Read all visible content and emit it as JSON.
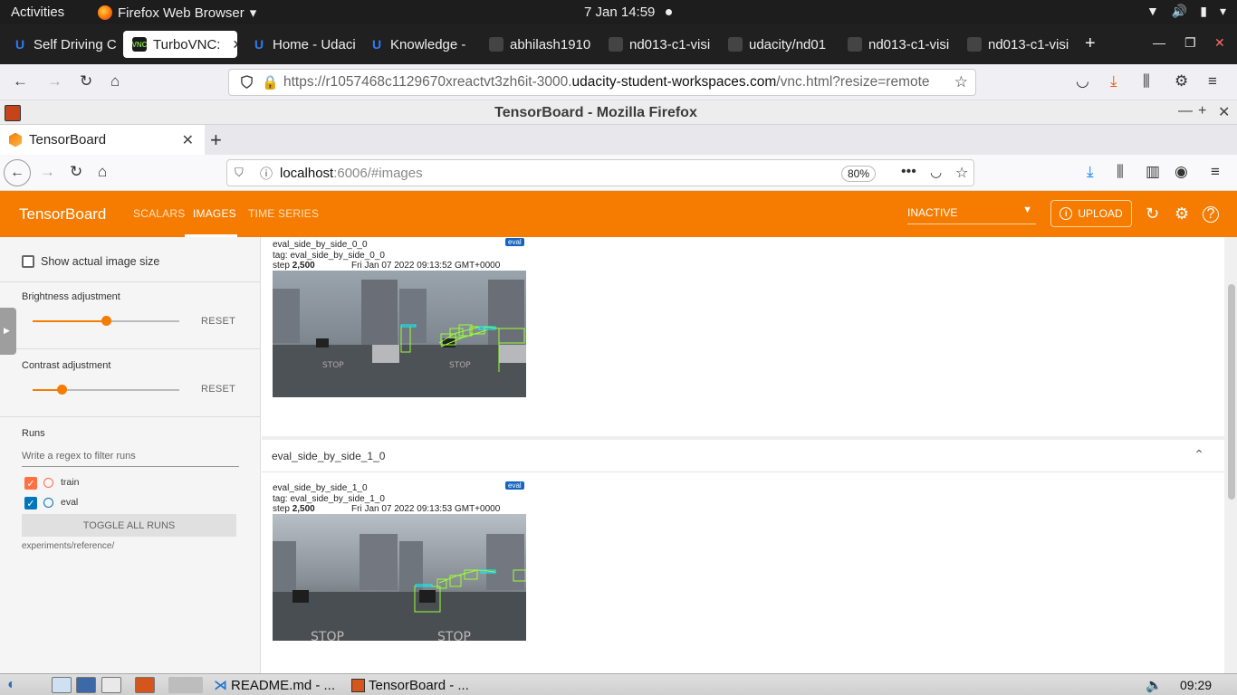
{
  "gnome": {
    "activities": "Activities",
    "app_name": "Firefox Web Browser",
    "clock": "7 Jan  14:59"
  },
  "outer_tabs": [
    {
      "label": "Self Driving C",
      "icon": "udacity-icon"
    },
    {
      "label": "TurboVNC:",
      "icon": "vnc-icon",
      "active": true
    },
    {
      "label": "Home - Udaci",
      "icon": "udacity-icon"
    },
    {
      "label": "Knowledge - ",
      "icon": "udacity-icon"
    },
    {
      "label": "abhilash1910",
      "icon": "github-icon"
    },
    {
      "label": "nd013-c1-visi",
      "icon": "github-icon"
    },
    {
      "label": "udacity/nd01",
      "icon": "github-icon"
    },
    {
      "label": "nd013-c1-visi",
      "icon": "github-icon"
    },
    {
      "label": "nd013-c1-visi",
      "icon": "github-icon"
    }
  ],
  "outer_url": {
    "prefix": "https://r1057468c1129670xreactvt3zh6it-3000.",
    "domain": "udacity-student-workspaces.com",
    "suffix": "/vnc.html?resize=remote"
  },
  "vnc_window_title": "TensorBoard - Mozilla Firefox",
  "inner_tab": {
    "label": "TensorBoard"
  },
  "inner_url": {
    "host": "localhost",
    "rest": ":6006/#images",
    "zoom": "80%"
  },
  "tensorboard": {
    "brand": "TensorBoard",
    "nav": [
      "SCALARS",
      "IMAGES",
      "TIME SERIES"
    ],
    "active_nav": "IMAGES",
    "run_select": "INACTIVE",
    "upload": "UPLOAD",
    "accent": "#f57c00"
  },
  "sidebar": {
    "show_actual_size": "Show actual image size",
    "brightness": {
      "label": "Brightness adjustment",
      "reset": "RESET",
      "value": 0.5
    },
    "contrast": {
      "label": "Contrast adjustment",
      "reset": "RESET",
      "value": 0.2
    },
    "runs_title": "Runs",
    "filter_placeholder": "Write a regex to filter runs",
    "runs": [
      {
        "name": "train",
        "color": "#ff7043",
        "checked": true
      },
      {
        "name": "eval",
        "color": "#0077bb",
        "checked": true
      }
    ],
    "toggle_all": "TOGGLE ALL RUNS",
    "log_dir": "experiments/reference/"
  },
  "cards": [
    {
      "title": "eval_side_by_side_0_0",
      "img_name": "eval_side_by_side_0_0",
      "tag": "tag: eval_side_by_side_0_0",
      "step_label": "step",
      "step": "2,500",
      "time": "Fri Jan 07 2022 09:13:52 GMT+0000 (GMT)",
      "badge": "eval"
    },
    {
      "title": "eval_side_by_side_1_0",
      "img_name": "eval_side_by_side_1_0",
      "tag": "tag: eval_side_by_side_1_0",
      "step_label": "step",
      "step": "2,500",
      "time": "Fri Jan 07 2022 09:13:53 GMT+0000 (GMT)",
      "badge": "eval"
    }
  ],
  "taskbar": {
    "items": [
      "README.md - ...",
      "TensorBoard - ..."
    ],
    "clock": "09:29"
  }
}
